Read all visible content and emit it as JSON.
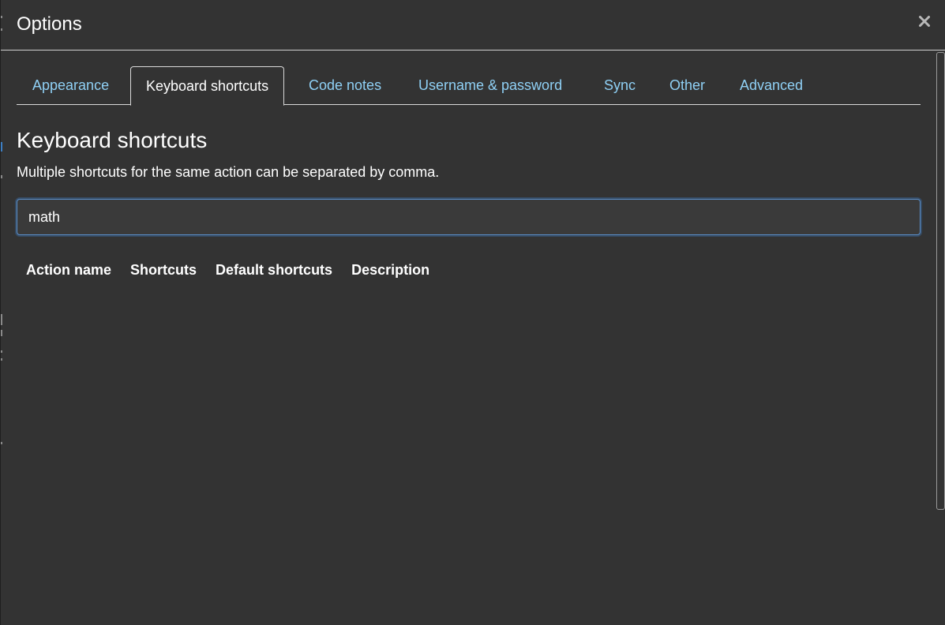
{
  "dialog": {
    "title": "Options",
    "close_label": "×"
  },
  "tabs": [
    {
      "label": "Appearance",
      "active": false
    },
    {
      "label": "Keyboard shortcuts",
      "active": true
    },
    {
      "label": "Code notes",
      "active": false
    },
    {
      "label": "Username & password",
      "active": false
    },
    {
      "label": "Sync",
      "active": false
    },
    {
      "label": "Other",
      "active": false
    },
    {
      "label": "Advanced",
      "active": false
    }
  ],
  "section": {
    "title": "Keyboard shortcuts",
    "description": "Multiple shortcuts for the same action can be separated by comma."
  },
  "filter": {
    "value": "math"
  },
  "table": {
    "columns": [
      "Action name",
      "Shortcuts",
      "Default shortcuts",
      "Description"
    ],
    "rows": []
  },
  "colors": {
    "background": "#333333",
    "link": "#8fd0f5",
    "focus_border": "#5b8fc9"
  }
}
